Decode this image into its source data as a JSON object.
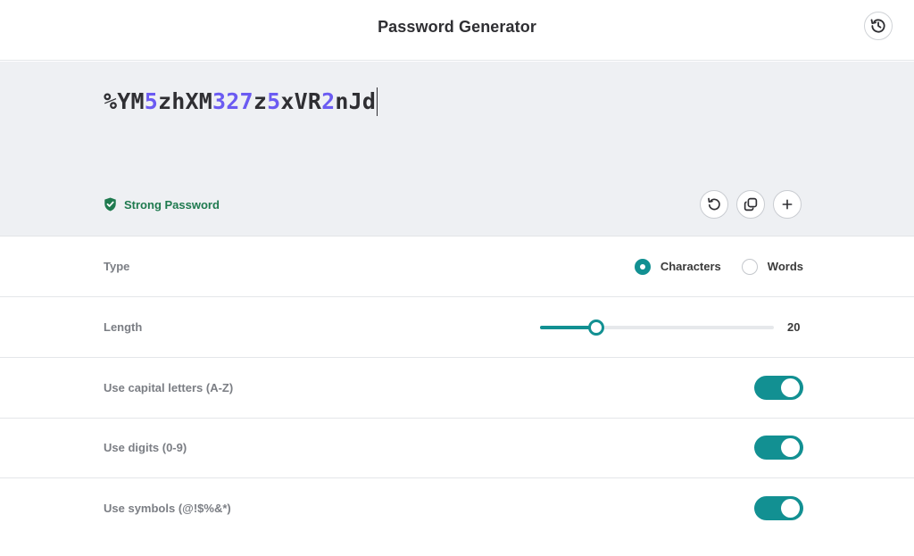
{
  "header": {
    "title": "Password Generator",
    "history_icon": "history-icon"
  },
  "password": {
    "segments": [
      {
        "text": "%YM",
        "digit": false
      },
      {
        "text": "5",
        "digit": true
      },
      {
        "text": "zhXM",
        "digit": false
      },
      {
        "text": "327",
        "digit": true
      },
      {
        "text": "z",
        "digit": false
      },
      {
        "text": "5",
        "digit": true
      },
      {
        "text": "xVR",
        "digit": false
      },
      {
        "text": "2",
        "digit": true
      },
      {
        "text": "nJd",
        "digit": false
      }
    ],
    "strength_label": "Strong Password",
    "strength_icon": "shield-check-icon",
    "actions": [
      {
        "name": "regenerate-button",
        "icon": "refresh-icon"
      },
      {
        "name": "copy-button",
        "icon": "copy-icon"
      },
      {
        "name": "add-button",
        "icon": "plus-icon"
      }
    ]
  },
  "settings": {
    "type": {
      "label": "Type",
      "options": [
        {
          "label": "Characters",
          "selected": true
        },
        {
          "label": "Words",
          "selected": false
        }
      ]
    },
    "length": {
      "label": "Length",
      "value": "20",
      "slider_fraction": 0.24
    },
    "capitals": {
      "label": "Use capital letters (A-Z)",
      "enabled": true
    },
    "digits": {
      "label": "Use digits (0-9)",
      "enabled": true
    },
    "symbols": {
      "label": "Use symbols (@!$%&*)",
      "enabled": true
    }
  },
  "colors": {
    "accent": "#129092",
    "digit_highlight": "#6b5bf2",
    "strength_green": "#1f7a4f",
    "panel_bg": "#eef0f3"
  }
}
